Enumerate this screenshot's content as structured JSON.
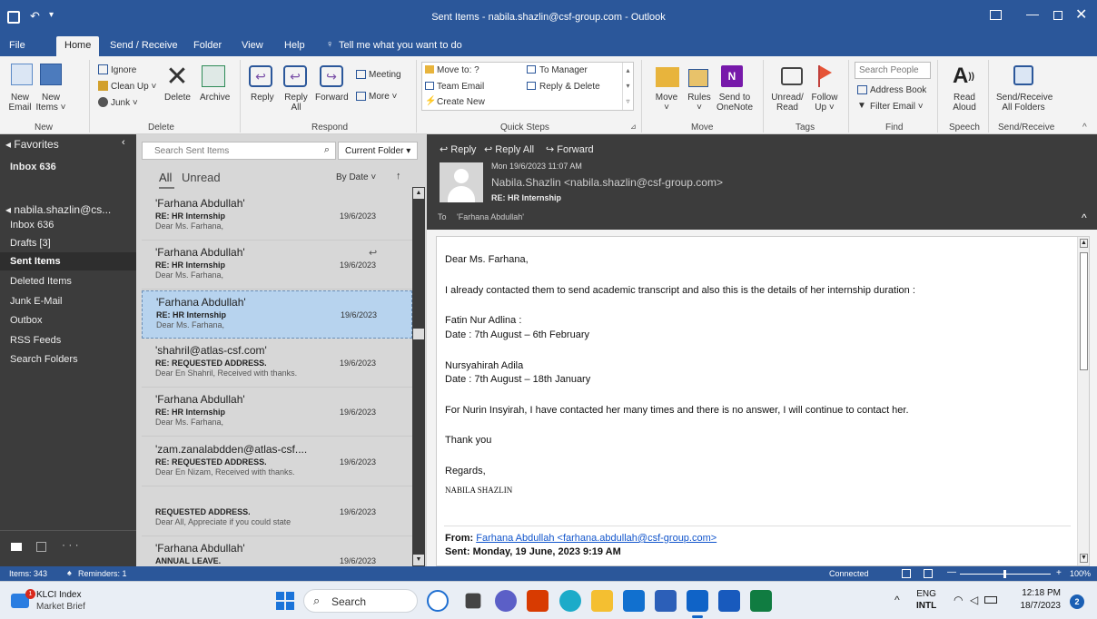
{
  "window": {
    "title": "Sent Items - nabila.shazlin@csf-group.com  -  Outlook"
  },
  "menu": {
    "items": [
      "File",
      "Home",
      "Send / Receive",
      "Folder",
      "View",
      "Help"
    ],
    "active": "Home",
    "tell_me": "Tell me what you want to do"
  },
  "ribbon": {
    "new_email": "New\nEmail",
    "new_items": "New\nItems ˅",
    "ignore": "Ignore",
    "clean_up": "Clean Up ˅",
    "junk": "Junk ˅",
    "delete": "Delete",
    "archive": "Archive",
    "reply": "Reply",
    "reply_all": "Reply\nAll",
    "forward": "Forward",
    "meeting": "Meeting",
    "more": "More ˅",
    "qs_move_to": "Move to: ?",
    "qs_team_email": "Team Email",
    "qs_create_new": "Create New",
    "qs_to_manager": "To Manager",
    "qs_reply_delete": "Reply & Delete",
    "move": "Move\n˅",
    "rules": "Rules\n˅",
    "send_onenote": "Send to\nOneNote",
    "unread_read": "Unread/\nRead",
    "follow_up": "Follow\nUp ˅",
    "search_people": "Search People",
    "address_book": "Address Book",
    "filter_email": "Filter Email ˅",
    "read_aloud": "Read\nAloud",
    "send_receive_all": "Send/Receive\nAll Folders",
    "groups": [
      "New",
      "Delete",
      "Respond",
      "Quick Steps",
      "Move",
      "Tags",
      "Find",
      "Speech",
      "Send/Receive"
    ]
  },
  "folders": {
    "favorites_label": "◂ Favorites",
    "favorites": [
      {
        "label": "Inbox 636"
      }
    ],
    "account": "◂ nabila.shazlin@cs...",
    "items": [
      "Inbox 636",
      "Drafts [3]",
      "Sent Items",
      "Deleted Items",
      "Junk E-Mail",
      "Outbox",
      "RSS Feeds",
      "Search Folders"
    ],
    "selected": "Sent Items"
  },
  "list": {
    "search_placeholder": "Search Sent Items",
    "scope": "Current Folder",
    "tab_all": "All",
    "tab_unread": "Unread",
    "sort": "By Date ˅",
    "messages": [
      {
        "from": "'Farhana Abdullah'",
        "subject": "RE: HR Internship",
        "preview": "Dear Ms. Farhana,",
        "date": "19/6/2023"
      },
      {
        "from": "'Farhana Abdullah'",
        "subject": "RE: HR Internship",
        "preview": "Dear Ms. Farhana,",
        "date": "19/6/2023"
      },
      {
        "from": "'Farhana Abdullah'",
        "subject": "RE: HR Internship",
        "preview": "Dear Ms. Farhana,",
        "date": "19/6/2023"
      },
      {
        "from": "'shahril@atlas-csf.com'",
        "subject": "RE: REQUESTED ADDRESS.",
        "preview": "Dear En Shahril,  Received with thanks.",
        "date": "19/6/2023"
      },
      {
        "from": "'Farhana Abdullah'",
        "subject": "RE: HR Internship",
        "preview": "Dear Ms. Farhana,",
        "date": "19/6/2023"
      },
      {
        "from": "'zam.zanalabdden@atlas-csf....",
        "subject": "RE: REQUESTED ADDRESS.",
        "preview": "Dear En Nizam,  Received with thanks.",
        "date": "19/6/2023"
      },
      {
        "from": "",
        "subject": "REQUESTED ADDRESS.",
        "preview": "Dear All,  Appreciate if you could state",
        "date": "19/6/2023"
      },
      {
        "from": "'Farhana Abdullah'",
        "subject": "ANNUAL LEAVE.",
        "preview": "",
        "date": "19/6/2023"
      }
    ]
  },
  "reading": {
    "reply": "Reply",
    "reply_all": "Reply All",
    "forward": "Forward",
    "date": "Mon 19/6/2023 11:07 AM",
    "sender": "Nabila.Shazlin <nabila.shazlin@csf-group.com>",
    "subject": "RE: HR Internship",
    "to_label": "To",
    "to": "'Farhana Abdullah'",
    "body": {
      "greeting": "Dear Ms. Farhana,",
      "p1": "I already contacted them to send academic transcript and also this is the details of her internship duration :",
      "name1": "Fatin Nur Adlina :",
      "date1": "Date : 7th August – 6th February",
      "name2": "Nursyahirah Adila",
      "date2": "Date : 7th August – 18th January",
      "p2": "For Nurin Insyirah, I have contacted her many times and there is no answer, I will continue to contact her.",
      "thanks": "Thank you",
      "regards": "Regards,",
      "sig": "NABILA SHAZLIN",
      "from_label": "From:",
      "from_value": "Farhana Abdullah <farhana.abdullah@csf-group.com>",
      "sent_label": "Sent:",
      "sent_value": "Monday, 19 June, 2023 9:19 AM"
    }
  },
  "status": {
    "items": "Items: 343",
    "reminders": "Reminders: 1",
    "connected": "Connected",
    "zoom": "100%"
  },
  "taskbar": {
    "widget_title": "KLCI Index",
    "widget_sub": "Market Brief",
    "widget_badge": "1",
    "search": "Search",
    "lang1": "ENG",
    "lang2": "INTL",
    "time": "12:18 PM",
    "date": "18/7/2023",
    "notif": "2"
  }
}
